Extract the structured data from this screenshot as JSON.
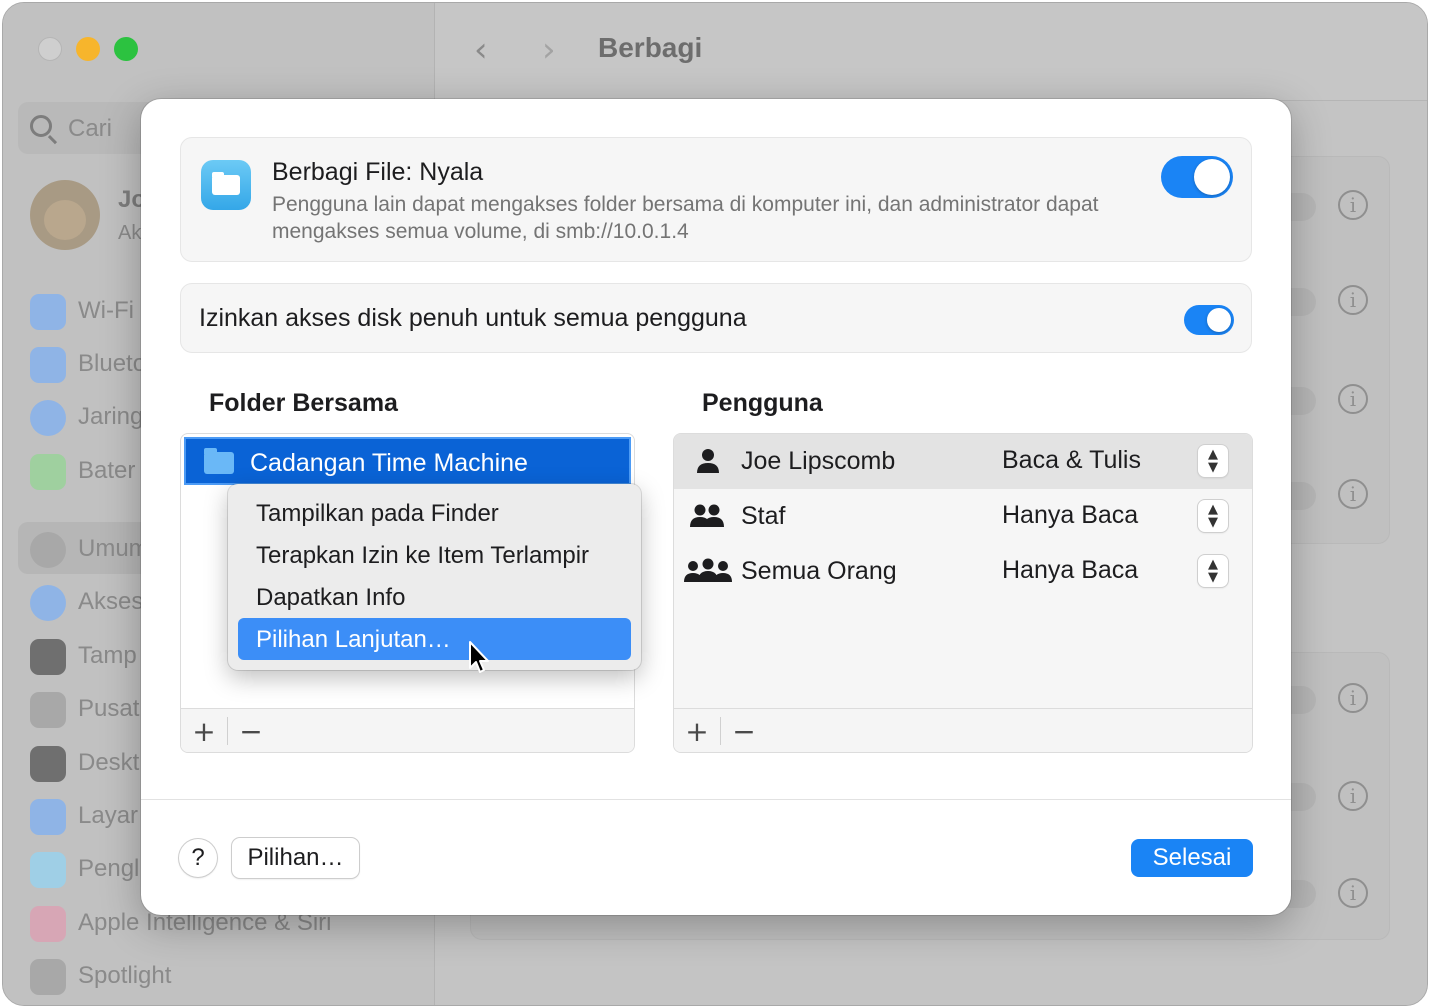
{
  "window": {
    "title": "Berbagi",
    "back_arrow": "‹",
    "forward_arrow": "›"
  },
  "sidebar": {
    "search_placeholder": "Cari",
    "user_name": "Jo",
    "user_sub": "Ak",
    "items": [
      {
        "label": "Wi-Fi",
        "icon": "wifi-icon",
        "color": "#3d8ef0"
      },
      {
        "label": "Blueto",
        "icon": "bluetooth-icon",
        "color": "#3d8ef0"
      },
      {
        "label": "Jaring",
        "icon": "network-icon",
        "color": "#3d8ef0"
      },
      {
        "label": "Bater",
        "icon": "battery-icon",
        "color": "#5ac85a"
      },
      {
        "label": "Umum",
        "icon": "general-icon",
        "color": "#8e8e93"
      },
      {
        "label": "Akses",
        "icon": "accessibility-icon",
        "color": "#3d8ef0"
      },
      {
        "label": "Tamp",
        "icon": "appearance-icon",
        "color": "#1d1d1f"
      },
      {
        "label": "Pusat",
        "icon": "control-center-icon",
        "color": "#8e8e93"
      },
      {
        "label": "Deskt",
        "icon": "desktop-icon",
        "color": "#1d1d1f"
      },
      {
        "label": "Layar",
        "icon": "display-icon",
        "color": "#3d8ef0"
      },
      {
        "label": "Pengl",
        "icon": "screensaver-icon",
        "color": "#5ac8fa"
      },
      {
        "label": "Apple Intelligence & Siri",
        "icon": "siri-icon",
        "color": "#ff6b6b"
      },
      {
        "label": "Spotlight",
        "icon": "spotlight-icon",
        "color": "#8e8e93"
      }
    ]
  },
  "sheet": {
    "file_sharing": {
      "title": "Berbagi File: Nyala",
      "description": "Pengguna lain dapat mengakses folder bersama di komputer ini, dan administrator dapat mengakses semua volume, di smb://10.0.1.4",
      "enabled": true
    },
    "full_disk": {
      "label": "Izinkan akses disk penuh untuk semua pengguna",
      "enabled": true
    },
    "folders": {
      "heading": "Folder Bersama",
      "items": [
        "Cadangan Time Machine"
      ],
      "add_label": "+",
      "remove_label": "−"
    },
    "users": {
      "heading": "Pengguna",
      "rows": [
        {
          "name": "Joe Lipscomb",
          "permission": "Baca & Tulis",
          "icon": "person-icon"
        },
        {
          "name": "Staf",
          "permission": "Hanya Baca",
          "icon": "group-icon"
        },
        {
          "name": "Semua Orang",
          "permission": "Hanya Baca",
          "icon": "everyone-icon"
        }
      ],
      "add_label": "+",
      "remove_label": "−"
    },
    "context_menu": {
      "items": [
        "Tampilkan pada Finder",
        "Terapkan Izin ke Item Terlampir",
        "Dapatkan Info",
        "Pilihan Lanjutan…"
      ],
      "highlighted_index": 3
    },
    "footer": {
      "help_label": "?",
      "options_label": "Pilihan…",
      "done_label": "Selesai"
    }
  },
  "colors": {
    "accent": "#1a84f5",
    "selection": "#0a63d6",
    "menu_highlight": "#3c8ef7"
  }
}
